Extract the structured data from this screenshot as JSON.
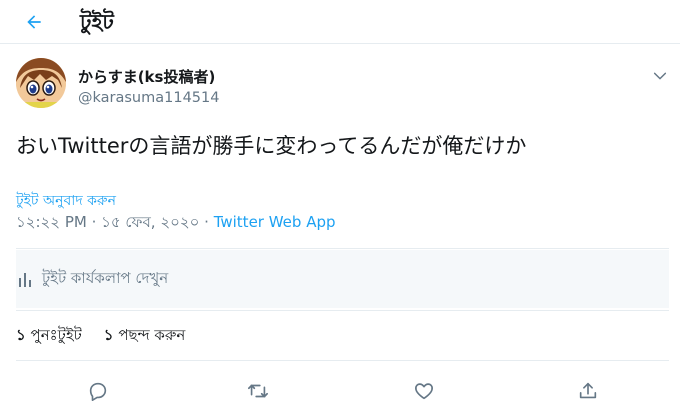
{
  "header": {
    "title": "টুইট",
    "back_icon": "back-arrow-icon"
  },
  "tweet": {
    "author": {
      "display_name": "からすま(ks投稿者)",
      "handle": "@karasuma114514"
    },
    "text": "おいTwitterの言語が勝手に変わってるんだが俺だけか",
    "translate_label": "টুইট অনুবাদ করুন",
    "time": "১২:২২ PM",
    "date": "১৫ ফেব, ২০২০",
    "separator": "·",
    "app": "Twitter Web App",
    "activity_label": "টুইট কার্যকলাপ দেখুন",
    "retweets": {
      "count": "১",
      "label": "পুনঃটুইট"
    },
    "likes": {
      "count": "১",
      "label": "পছন্দ করুন"
    }
  },
  "icons": {
    "reply": "reply-icon",
    "retweet": "retweet-icon",
    "like": "heart-icon",
    "share": "share-icon",
    "more": "chevron-down-icon",
    "activity": "bar-chart-icon"
  },
  "colors": {
    "accent": "#1da1f2",
    "secondary_text": "#657786",
    "border": "#e6ecf0"
  }
}
